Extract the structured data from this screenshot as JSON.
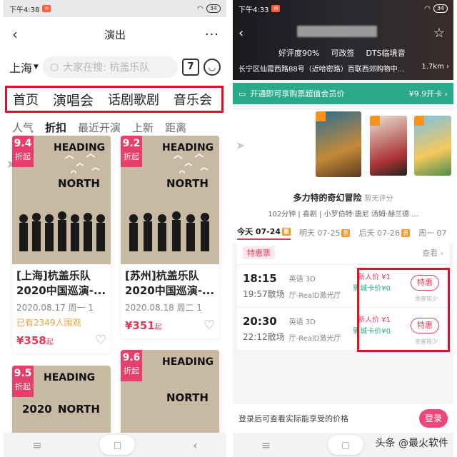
{
  "left": {
    "status": {
      "time": "下午4:38",
      "battery": "34"
    },
    "nav": {
      "title": "演出",
      "more": "···"
    },
    "search": {
      "city": "上海",
      "placeholder": "大家在搜: 杭盖乐队",
      "calendar_day": "7"
    },
    "categories": [
      "首页",
      "演唱会",
      "话剧歌剧",
      "音乐会"
    ],
    "filters": [
      "人气",
      "折扣",
      "最近开演",
      "上新",
      "距离"
    ],
    "cards": [
      {
        "score": "9.4",
        "score_label": "折起",
        "title": "[上海]杭盖乐队2020中国巡演-...",
        "date": "2020.08.17 周一 1",
        "viewers": "已有2349人围观",
        "price": "¥358",
        "price_suffix": "起"
      },
      {
        "score": "9.2",
        "score_label": "折起",
        "title": "[苏州]杭盖乐队2020中国巡演-...",
        "date": "2020.08.18 周二 1",
        "viewers": "",
        "price": "¥351",
        "price_suffix": "起"
      },
      {
        "score": "9.5",
        "score_label": "折起"
      },
      {
        "score": "9.6",
        "score_label": "折起"
      }
    ],
    "poster_text": {
      "heading": "HEADING",
      "north": "NORTH",
      "letters": "A N G G A",
      "year": "2020"
    },
    "bottom_nav": {
      "menu": "≡",
      "home": "□",
      "back": "‹"
    }
  },
  "right": {
    "status": {
      "time": "下午4:33",
      "battery": "34"
    },
    "hero": {
      "tags": [
        "好评度90%",
        "可改签",
        "DTS临境音"
      ],
      "address": "长宁区仙霞西路88号（近哈密路）百联西郊购物中...",
      "distance": "1.7km ›"
    },
    "member": {
      "text": "开通即可享购票超值会员价",
      "price": "¥9.9开卡 ›"
    },
    "film": {
      "name": "多力特的奇幻冒险",
      "score": "暂无评分",
      "meta": "102分钟 | 喜剧 | 小罗伯特·唐尼 汤姆·赫兰德 ..."
    },
    "dates": [
      {
        "label": "今天 07-24",
        "badge": "惠"
      },
      {
        "label": "明天 07-25",
        "badge": "惠"
      },
      {
        "label": "后天 07-26",
        "badge": "惠"
      },
      {
        "label": "周一 07",
        "badge": ""
      }
    ],
    "schedule": {
      "tag": "特惠票",
      "more": "查看 ›",
      "rows": [
        {
          "start": "18:15",
          "end": "19:57散场",
          "lang": "英语 3D",
          "hall": "厅-RealD激光厅",
          "new_price": "新人价 ¥1",
          "member_price": "影城卡价¥0",
          "button": "特惠",
          "few": "余座较少"
        },
        {
          "start": "20:30",
          "end": "22:12散场",
          "lang": "英语 3D",
          "hall": "厅-RealD激光厅",
          "new_price": "新人价 ¥1",
          "member_price": "影城卡价¥0",
          "button": "特惠",
          "few": "余座较少"
        }
      ]
    },
    "login": {
      "text": "登录后可查看实际能享受的价格",
      "button": "登录"
    }
  },
  "watermark": "头条 @最火软件",
  "colors": {
    "highlight_red": "#e0102a",
    "pink": "#e03a5a",
    "teal": "#2aa98b"
  }
}
